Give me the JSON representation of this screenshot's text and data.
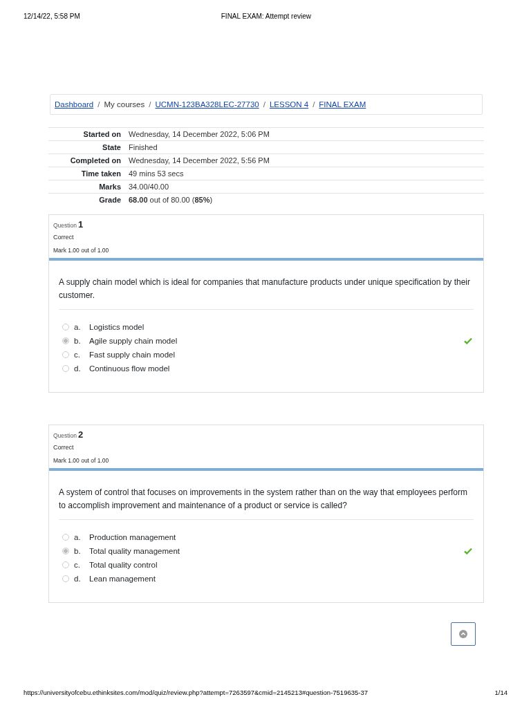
{
  "print_header": {
    "date": "12/14/22, 5:58 PM",
    "title": "FINAL EXAM: Attempt review"
  },
  "breadcrumb": [
    {
      "label": "Dashboard",
      "link": true
    },
    {
      "label": "My courses",
      "link": false
    },
    {
      "label": "UCMN-123BA328LEC-27730",
      "link": true
    },
    {
      "label": "LESSON 4",
      "link": true
    },
    {
      "label": "FINAL EXAM",
      "link": true
    }
  ],
  "breadcrumb_separator": "/",
  "summary": [
    {
      "label": "Started on",
      "value": "Wednesday, 14 December 2022, 5:06 PM"
    },
    {
      "label": "State",
      "value": "Finished"
    },
    {
      "label": "Completed on",
      "value": "Wednesday, 14 December 2022, 5:56 PM"
    },
    {
      "label": "Time taken",
      "value": "49 mins 53 secs"
    },
    {
      "label": "Marks",
      "value": "34.00/40.00"
    },
    {
      "label": "Grade",
      "value": "**68.00** out of 80.00 (**85%**)"
    }
  ],
  "questions": [
    {
      "label": "Question",
      "number": "1",
      "status": "Correct",
      "mark": "Mark 1.00 out of 1.00",
      "text": "A supply chain model which is ideal for companies that manufacture products under unique specification by their customer.",
      "options": [
        {
          "letter": "a.",
          "text": "Logistics model",
          "selected": false,
          "correct": false
        },
        {
          "letter": "b.",
          "text": "Agile supply chain model",
          "selected": true,
          "correct": true
        },
        {
          "letter": "c.",
          "text": "Fast supply chain model",
          "selected": false,
          "correct": false
        },
        {
          "letter": "d.",
          "text": "Continuous flow model",
          "selected": false,
          "correct": false
        }
      ]
    },
    {
      "label": "Question",
      "number": "2",
      "status": "Correct",
      "mark": "Mark 1.00 out of 1.00",
      "text": "A system of control that focuses on improvements in the system rather than on the way that employees perform to accomplish improvement and maintenance of a product or service is called?",
      "options": [
        {
          "letter": "a.",
          "text": "Production management",
          "selected": false,
          "correct": false
        },
        {
          "letter": "b.",
          "text": "Total quality management",
          "selected": true,
          "correct": true
        },
        {
          "letter": "c.",
          "text": "Total quality control",
          "selected": false,
          "correct": false
        },
        {
          "letter": "d.",
          "text": "Lean management",
          "selected": false,
          "correct": false
        }
      ]
    }
  ],
  "print_footer": {
    "url": "https://universityofcebu.ethinksites.com/mod/quiz/review.php?attempt=7263597&cmid=2145213#question-7519635-37",
    "page": "1/14"
  }
}
